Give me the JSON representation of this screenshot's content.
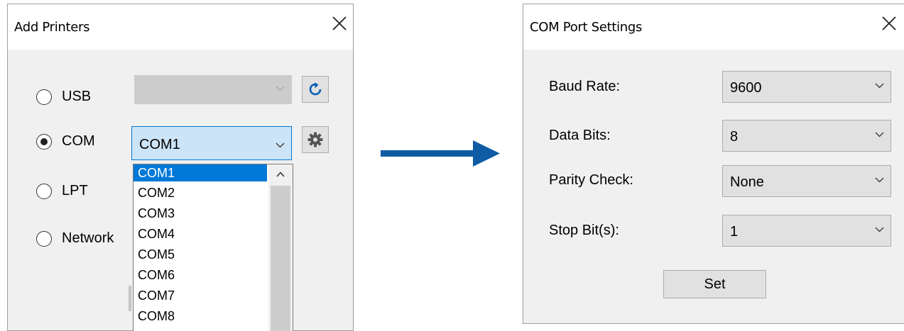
{
  "add_printers": {
    "title": "Add Printers",
    "options": [
      {
        "label": "USB",
        "checked": false
      },
      {
        "label": "COM",
        "checked": true
      },
      {
        "label": "LPT",
        "checked": false
      },
      {
        "label": "Network",
        "checked": false
      }
    ],
    "usb_combo_value": "",
    "com_combo_value": "COM1",
    "refresh_icon": "refresh-icon",
    "settings_icon": "gear-icon",
    "com_dropdown": {
      "items": [
        "COM1",
        "COM2",
        "COM3",
        "COM4",
        "COM5",
        "COM6",
        "COM7",
        "COM8"
      ],
      "selected": "COM1"
    }
  },
  "com_port_settings": {
    "title": "COM Port Settings",
    "fields": [
      {
        "label": "Baud Rate:",
        "value": "9600"
      },
      {
        "label": "Data Bits:",
        "value": "8"
      },
      {
        "label": "Parity Check:",
        "value": "None"
      },
      {
        "label": "Stop Bit(s):",
        "value": "1"
      }
    ],
    "set_label": "Set"
  },
  "colors": {
    "selection": "#0078d7",
    "arrow": "#0f5ba4",
    "dialog_bg": "#f0f0f0",
    "control_bg": "#e1e1e1"
  }
}
